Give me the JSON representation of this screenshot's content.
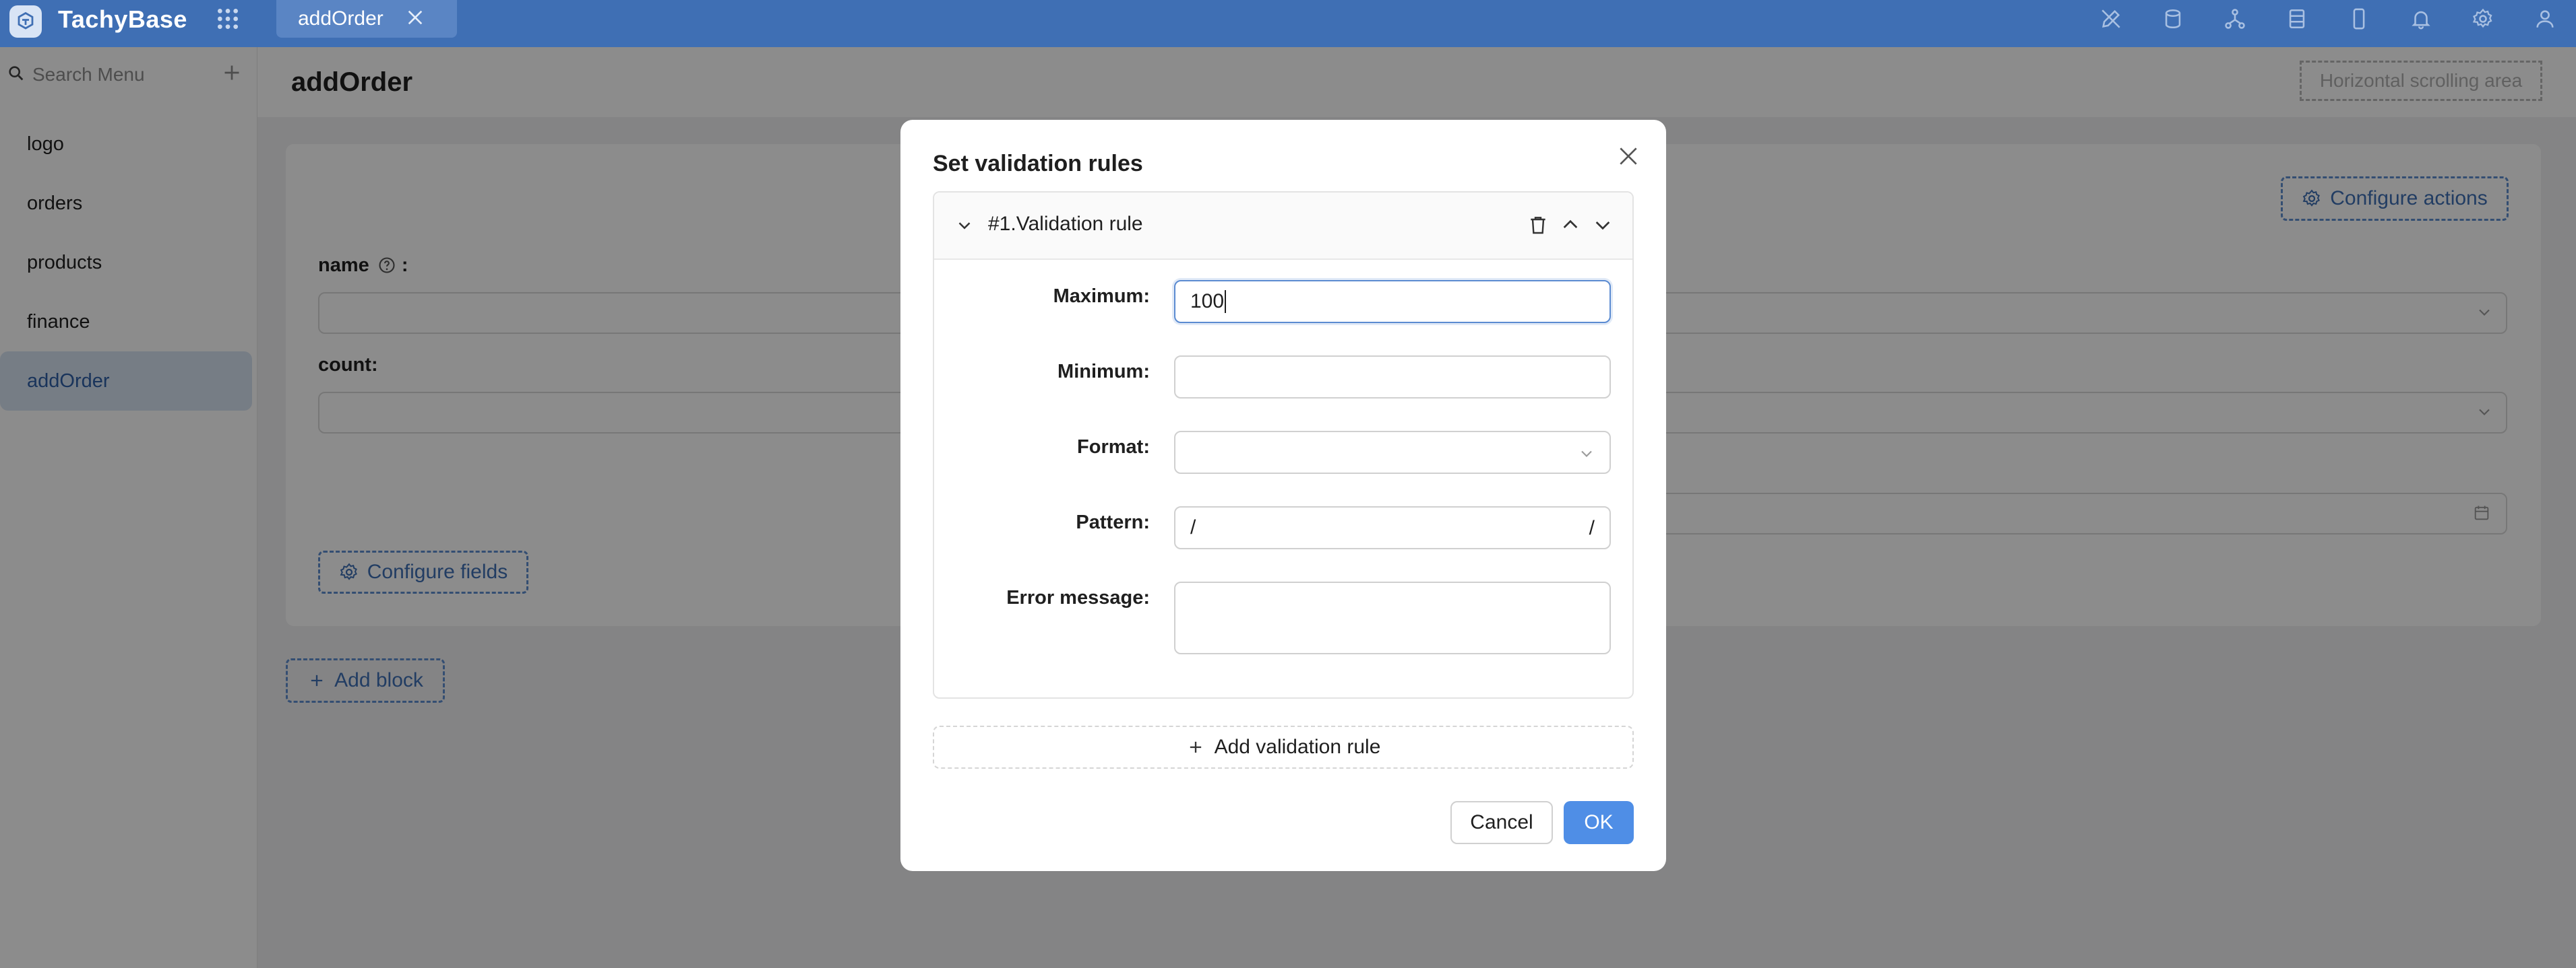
{
  "app": {
    "title": "TachyBase"
  },
  "tabs": [
    {
      "label": "addOrder"
    }
  ],
  "sidebar": {
    "search_placeholder": "Search Menu",
    "items": [
      {
        "label": "logo"
      },
      {
        "label": "orders"
      },
      {
        "label": "products"
      },
      {
        "label": "finance"
      },
      {
        "label": "addOrder",
        "active": true
      }
    ]
  },
  "page": {
    "title": "addOrder",
    "horizontal_scroll_label": "Horizontal scrolling area",
    "configure_actions_label": "Configure actions",
    "configure_fields_label": "Configure fields",
    "add_block_label": "Add block",
    "fields": [
      {
        "label": "name",
        "suffix": ":"
      },
      {
        "label": "count",
        "suffix": ":"
      }
    ]
  },
  "modal": {
    "title": "Set validation rules",
    "rule_title": "#1.Validation rule",
    "labels": {
      "maximum": "Maximum",
      "minimum": "Minimum",
      "format": "Format",
      "pattern": "Pattern",
      "error_message": "Error message"
    },
    "colon": ":",
    "values": {
      "maximum": "100",
      "minimum": "",
      "format": "",
      "pattern_left": "/",
      "pattern_right": "/",
      "error_message": ""
    },
    "add_rule_label": "Add validation rule",
    "cancel_label": "Cancel",
    "ok_label": "OK"
  },
  "colors": {
    "topbar": "#3f6fb4",
    "accent": "#4f8ee6",
    "active_menu_bg": "#d8e3f3"
  },
  "icons": [
    "apps-icon",
    "close-icon",
    "search-icon",
    "plus-icon",
    "gear-icon",
    "trash-icon",
    "chevron-up-icon",
    "chevron-down-icon",
    "bell-icon",
    "user-icon"
  ]
}
